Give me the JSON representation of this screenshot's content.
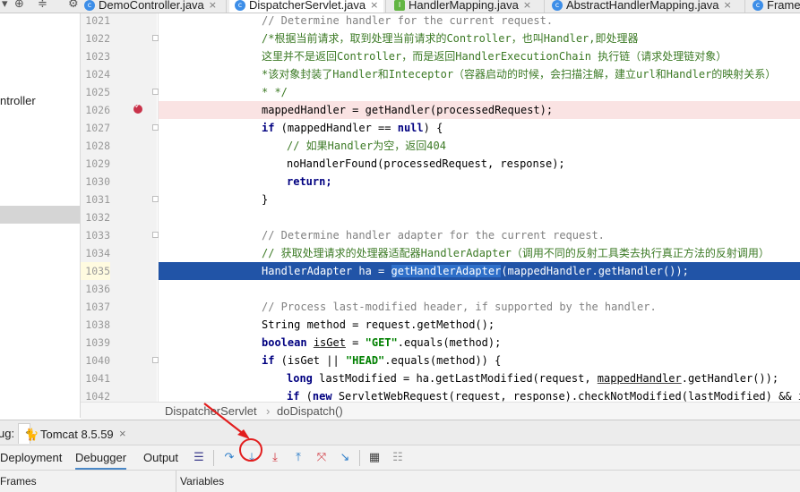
{
  "tabs": [
    {
      "label": "DemoController.java",
      "icon": "class-icon"
    },
    {
      "label": "DispatcherServlet.java",
      "icon": "class-icon",
      "active": true
    },
    {
      "label": "HandlerMapping.java",
      "icon": "interface-icon"
    },
    {
      "label": "AbstractHandlerMapping.java",
      "icon": "class-icon"
    },
    {
      "label": "Framew",
      "icon": "class-icon"
    }
  ],
  "project": {
    "partial_item": "ntroller"
  },
  "gutter": {
    "line_numbers": [
      "1021",
      "1022",
      "1023",
      "1024",
      "1025",
      "1026",
      "1027",
      "1028",
      "1029",
      "1030",
      "1031",
      "1032",
      "1033",
      "1034",
      "1035",
      "1036",
      "1037",
      "1038",
      "1039",
      "1040",
      "1041",
      "1042"
    ],
    "breakpoint_line": "1026",
    "execution_line": "1035"
  },
  "code": {
    "l1021": "// Determine handler for the current request.",
    "l1022": "/*根据当前请求，取到处理当前请求的Controller，也叫Handler,即处理器",
    "l1023": "这里并不是返回Controller，而是返回HandlerExecutionChain 执行链（请求处理链对象）",
    "l1024": "*该对象封装了Handler和Inteceptor（容器启动的时候，会扫描注解，建立url和Handler的映射关系）",
    "l1025": "* */",
    "l1026": "mappedHandler = getHandler(processedRequest);",
    "l1027a": "if",
    "l1027b": " (mappedHandler == ",
    "l1027c": "null",
    "l1027d": ") {",
    "l1028": "// 如果Handler为空，返回404",
    "l1029": "noHandlerFound(processedRequest, response);",
    "l1030": "return;",
    "l1031": "}",
    "l1033": "// Determine handler adapter for the current request.",
    "l1034": "// 获取处理请求的处理器适配器HandlerAdapter（调用不同的反射工具类去执行真正方法的反射调用）",
    "l1035a": "HandlerAdapter ha = ",
    "l1035b": "getHandlerAdapter",
    "l1035c": "(mappedHandler.getHandler());",
    "l1037": "// Process last-modified header, if supported by the handler.",
    "l1038": "String method = request.getMethod();",
    "l1039a": "boolean",
    "l1039b": "isGet",
    "l1039c": " = ",
    "l1039d": "\"GET\"",
    "l1039e": ".equals(method);",
    "l1040a": "if",
    "l1040b": " (isGet || ",
    "l1040c": "\"HEAD\"",
    "l1040d": ".equals(method)) {",
    "l1041a": "long",
    "l1041b": " lastModified = ha.getLastModified(request, ",
    "l1041c": "mappedHandler",
    "l1041d": ".getHandler());",
    "l1042a": "if",
    "l1042b": " (",
    "l1042c": "new",
    "l1042d": " ServletWebRequest(request, response).checkNotModified(lastModified) && isGe"
  },
  "breadcrumb": {
    "class": "DispatcherServlet",
    "separator": "›",
    "method": "doDispatch()"
  },
  "debug": {
    "header_prefix": "ug:",
    "run_config": "Tomcat 8.5.59",
    "tabs": {
      "deployment": "Deployment",
      "debugger": "Debugger",
      "output": "Output"
    },
    "toolbar_icons": [
      "show-execution-point-icon",
      "step-over-icon",
      "step-into-icon",
      "force-step-into-icon",
      "step-out-icon",
      "drop-frame-icon",
      "run-to-cursor-icon",
      "evaluate-expression-icon",
      "trace-icon"
    ],
    "panes": {
      "frames": "Frames",
      "variables": "Variables"
    }
  },
  "colors": {
    "execution_line": "#2154a7",
    "breakpoint": "#c9334a",
    "annotation": "#e21d1d"
  }
}
